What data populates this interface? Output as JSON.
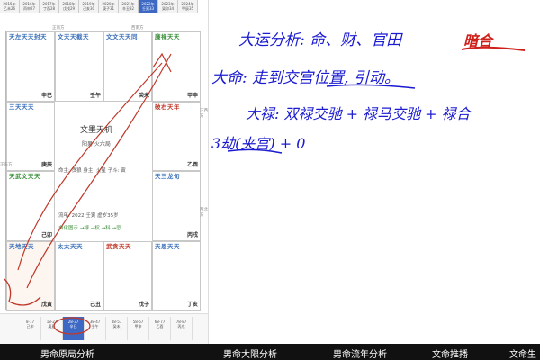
{
  "year_tabs": [
    {
      "top": "2015年",
      "bottom": "乙未26",
      "active": false
    },
    {
      "top": "2016年",
      "bottom": "丙申27",
      "active": false
    },
    {
      "top": "2017年",
      "bottom": "丁酉28",
      "active": false
    },
    {
      "top": "2018年",
      "bottom": "戊戌29",
      "active": false
    },
    {
      "top": "2019年",
      "bottom": "己亥30",
      "active": false
    },
    {
      "top": "2020年",
      "bottom": "庚子31",
      "active": false
    },
    {
      "top": "2021年",
      "bottom": "辛丑32",
      "active": false
    },
    {
      "top": "2022年",
      "bottom": "壬寅33",
      "active": true
    },
    {
      "top": "2023年",
      "bottom": "癸卯34",
      "active": false
    },
    {
      "top": "2024年",
      "bottom": "甲辰35",
      "active": false
    }
  ],
  "direction_labels": {
    "south": "正南方",
    "southwest": "西南方",
    "west": "正西方",
    "northwest": "西北方",
    "east": "正东方"
  },
  "palaces": [
    {
      "stars": "天左天天封天",
      "color": "blue",
      "branch": "辛巳",
      "hl": false
    },
    {
      "stars": "文天天截天",
      "color": "blue",
      "branch": "壬午",
      "hl": false
    },
    {
      "stars": "文文天天同",
      "color": "blue",
      "branch": "癸未",
      "hl": false
    },
    {
      "stars": "廉禄天天",
      "color": "green",
      "branch": "甲申",
      "hl": false
    },
    {
      "stars": "三天天天",
      "color": "blue",
      "branch": "庚辰",
      "hl": false
    },
    {
      "stars": "破右天年",
      "color": "red",
      "branch": "乙酉",
      "hl": false
    },
    {
      "stars": "天武文天天",
      "color": "green",
      "branch": "己卯",
      "hl": false
    },
    {
      "stars": "天三龙旬",
      "color": "blue",
      "branch": "丙戌",
      "hl": false
    },
    {
      "stars": "天地天天",
      "color": "blue",
      "branch": "戊寅",
      "hl": true
    },
    {
      "stars": "太太天天",
      "color": "blue",
      "branch": "己丑",
      "hl": false
    },
    {
      "stars": "武贪天天",
      "color": "red",
      "branch": "戊子",
      "hl": false
    },
    {
      "stars": "天恩天天",
      "color": "blue",
      "branch": "丁亥",
      "hl": false
    }
  ],
  "center": {
    "title": "文墨天机",
    "gender_line": "阳男 火六局",
    "ming_line": "命主: 贪狼 身主: 火星 子斗: 寅",
    "year_line": "流年: 2022 壬寅 虚岁35岁",
    "hua_line": "自化图示 →禄 →权 →科 →忌"
  },
  "bottom_tabs": [
    {
      "top": "8-17",
      "bottom": "己卯",
      "active": false
    },
    {
      "top": "18-27",
      "bottom": "庚辰",
      "active": false
    },
    {
      "top": "28-37",
      "bottom": "辛巳",
      "active": true
    },
    {
      "top": "38-47",
      "bottom": "壬午",
      "active": false
    },
    {
      "top": "48-57",
      "bottom": "癸未",
      "active": false
    },
    {
      "top": "58-67",
      "bottom": "甲申",
      "active": false
    },
    {
      "top": "68-77",
      "bottom": "乙酉",
      "active": false
    },
    {
      "top": "78-87",
      "bottom": "丙戌",
      "active": false
    }
  ],
  "notes": {
    "line1": "大运分析: 命、财、官田",
    "line1_tag": "暗合",
    "line2": "大命: 走到交宫位置, 引动。",
    "line3": "大禄: 双禄交驰 + 禄马交驰 + 禄合",
    "line4": "3劫(夹宫) + 0"
  },
  "subtitles": [
    "男命原局分析",
    "男命大限分析",
    "男命流年分析",
    "文命推播",
    "文命生"
  ]
}
